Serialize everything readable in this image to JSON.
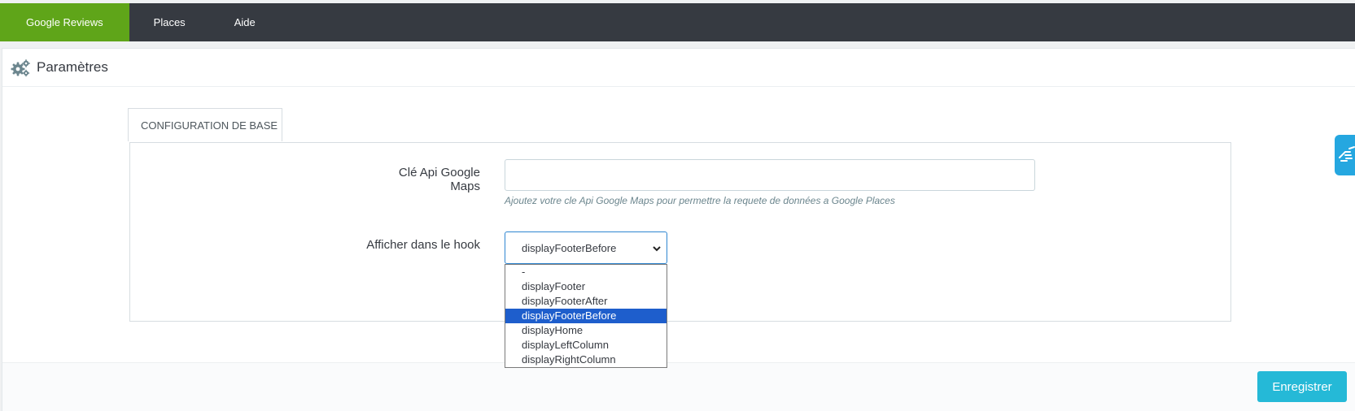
{
  "nav": {
    "tabs": [
      {
        "label": "Google Reviews",
        "active": true
      },
      {
        "label": "Places",
        "active": false
      },
      {
        "label": "Aide",
        "active": false
      }
    ]
  },
  "panel": {
    "title": "Paramètres",
    "icon": "gears-icon"
  },
  "config_tab": {
    "label": "CONFIGURATION DE BASE"
  },
  "form": {
    "api_key": {
      "label": "Clé Api Google Maps",
      "value": "",
      "help": "Ajoutez votre cle Api Google Maps pour permettre la requete de données a Google Places"
    },
    "hook": {
      "label": "Afficher dans le hook",
      "selected": "displayFooterBefore",
      "options": [
        "-",
        "displayFooter",
        "displayFooterAfter",
        "displayFooterBefore",
        "displayHome",
        "displayLeftColumn",
        "displayRightColumn"
      ]
    }
  },
  "footer": {
    "save_label": "Enregistrer"
  },
  "colors": {
    "topbar": "#363a41",
    "active_tab": "#5fa519",
    "primary_button": "#25b9d7",
    "selected_option": "#1e5ecc",
    "side_widget": "#25a7e0"
  }
}
